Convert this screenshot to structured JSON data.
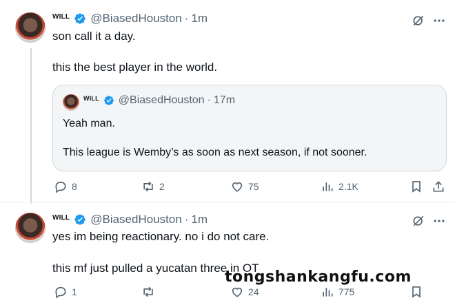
{
  "tweet1": {
    "name": "WILL",
    "handle": "@BiasedHouston",
    "separator": "·",
    "time": "1m",
    "line1": "son call it a day.",
    "line2": "this the best player in the world.",
    "quote": {
      "name": "WILL",
      "handle": "@BiasedHouston",
      "separator": "·",
      "time": "17m",
      "line1": "Yeah man.",
      "line2": "This league is Wemby’s as soon as next season, if not sooner."
    },
    "stats": {
      "replies": "8",
      "reposts": "2",
      "likes": "75",
      "views": "2.1K"
    }
  },
  "tweet2": {
    "name": "WILL",
    "handle": "@BiasedHouston",
    "separator": "·",
    "time": "1m",
    "line1": "yes im being reactionary. no i do not care.",
    "line2": "this mf just pulled a yucatan three in OT",
    "stats": {
      "replies": "1",
      "reposts": "",
      "likes": "24",
      "views": "775"
    }
  },
  "watermark": "tongshankangfu.com",
  "colors": {
    "verified": "#1d9bf0",
    "muted": "#536471",
    "text": "#0f1419",
    "border": "#cfd9de"
  }
}
